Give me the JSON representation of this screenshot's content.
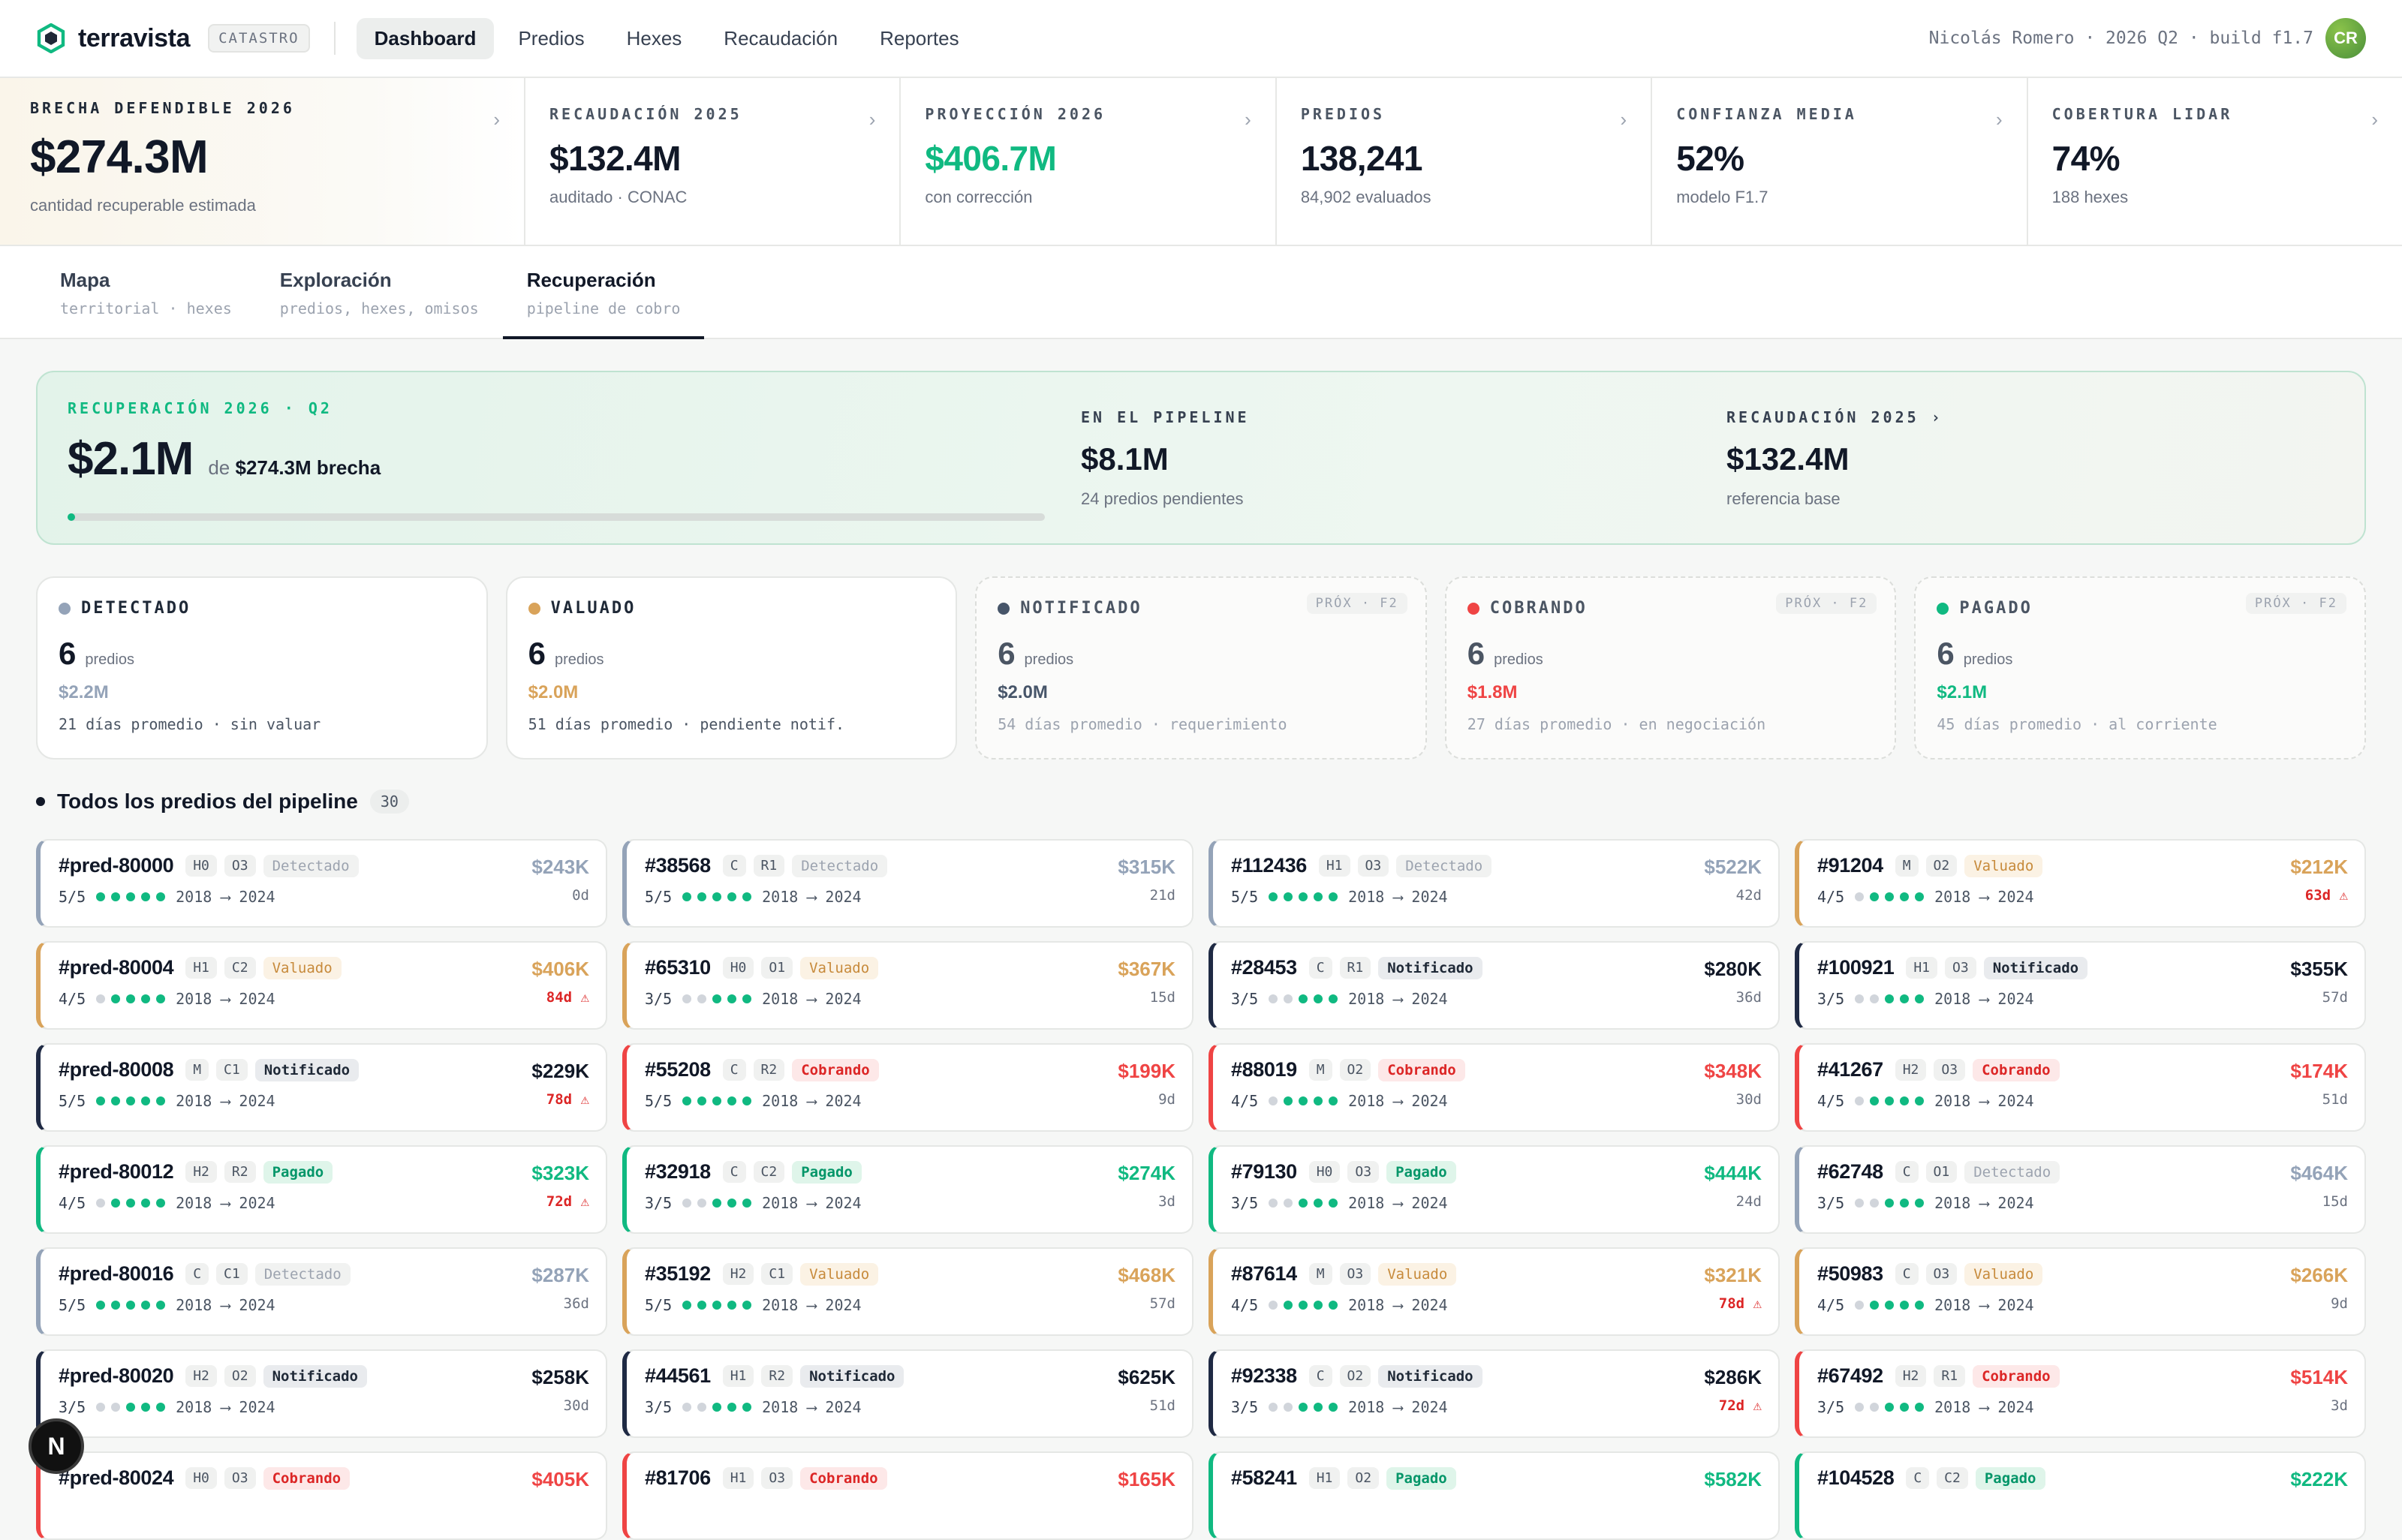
{
  "app": {
    "name": "terravista",
    "tag": "CATASTRO",
    "user_info": "Nicolás Romero · 2026 Q2 · build f1.7",
    "avatar": "CR"
  },
  "nav": [
    {
      "label": "Dashboard",
      "active": true
    },
    {
      "label": "Predios"
    },
    {
      "label": "Hexes"
    },
    {
      "label": "Recaudación"
    },
    {
      "label": "Reportes"
    }
  ],
  "kpis": [
    {
      "label": "BRECHA DEFENDIBLE 2026",
      "value": "$274.3M",
      "sub": "cantidad recuperable estimada"
    },
    {
      "label": "RECAUDACIÓN 2025",
      "value": "$132.4M",
      "sub": "auditado · CONAC"
    },
    {
      "label": "PROYECCIÓN 2026",
      "value": "$406.7M",
      "sub": "con corrección",
      "accent": "#10b981"
    },
    {
      "label": "PREDIOS",
      "value": "138,241",
      "sub": "84,902 evaluados"
    },
    {
      "label": "CONFIANZA MEDIA",
      "value": "52%",
      "sub": "modelo F1.7"
    },
    {
      "label": "COBERTURA LIDAR",
      "value": "74%",
      "sub": "188 hexes"
    }
  ],
  "tabs": [
    {
      "title": "Mapa",
      "sub": "territorial · hexes"
    },
    {
      "title": "Exploración",
      "sub": "predios, hexes, omisos"
    },
    {
      "title": "Recuperación",
      "sub": "pipeline de cobro",
      "active": true
    }
  ],
  "recovery": {
    "label": "RECUPERACIÓN 2026 · Q2",
    "amount": "$2.1M",
    "of_text": "de",
    "of_value": "$274.3M brecha",
    "progress": 0.0077,
    "pipeline": {
      "label": "EN EL PIPELINE",
      "value": "$8.1M",
      "sub": "24 predios pendientes"
    },
    "base": {
      "label": "RECAUDACIÓN 2025 ›",
      "value": "$132.4M",
      "sub": "referencia base"
    }
  },
  "stages": [
    {
      "name": "DETECTADO",
      "count": "6",
      "unit": "predios",
      "amount": "$2.2M",
      "foot": "21 días promedio · sin valuar",
      "color": "#94a3b8"
    },
    {
      "name": "VALUADO",
      "count": "6",
      "unit": "predios",
      "amount": "$2.0M",
      "foot": "51 días promedio · pendiente notif.",
      "color": "#d9a35a"
    },
    {
      "name": "NOTIFICADO",
      "count": "6",
      "unit": "predios",
      "amount": "$2.0M",
      "foot": "54 días promedio · requerimiento",
      "color": "#475569",
      "badge": "PRÓX · F2"
    },
    {
      "name": "COBRANDO",
      "count": "6",
      "unit": "predios",
      "amount": "$1.8M",
      "foot": "27 días promedio · en negociación",
      "color": "#ef4444",
      "badge": "PRÓX · F2"
    },
    {
      "name": "PAGADO",
      "count": "6",
      "unit": "predios",
      "amount": "$2.1M",
      "foot": "45 días promedio · al corriente",
      "color": "#10b981",
      "badge": "PRÓX · F2"
    }
  ],
  "list": {
    "title": "Todos los predios del pipeline",
    "count": "30"
  },
  "cards": [
    {
      "id": "#pred-80000",
      "c1": "H0",
      "c2": "O3",
      "status": "Detectado",
      "amount": "$243K",
      "days": "0d",
      "score": "5/5",
      "dots": 5,
      "years": "2018 ⟶ 2024"
    },
    {
      "id": "#38568",
      "c1": "C",
      "c2": "R1",
      "status": "Detectado",
      "amount": "$315K",
      "days": "21d",
      "score": "5/5",
      "dots": 5,
      "years": "2018 ⟶ 2024"
    },
    {
      "id": "#112436",
      "c1": "H1",
      "c2": "O3",
      "status": "Detectado",
      "amount": "$522K",
      "days": "42d",
      "score": "5/5",
      "dots": 5,
      "years": "2018 ⟶ 2024"
    },
    {
      "id": "#91204",
      "c1": "M",
      "c2": "O2",
      "status": "Valuado",
      "amount": "$212K",
      "days": "63d ⚠",
      "warn": true,
      "score": "4/5",
      "dots": 4,
      "years": "2018 ⟶ 2024"
    },
    {
      "id": "#pred-80004",
      "c1": "H1",
      "c2": "C2",
      "status": "Valuado",
      "amount": "$406K",
      "days": "84d ⚠",
      "warn": true,
      "score": "4/5",
      "dots": 4,
      "years": "2018 ⟶ 2024"
    },
    {
      "id": "#65310",
      "c1": "H0",
      "c2": "O1",
      "status": "Valuado",
      "amount": "$367K",
      "days": "15d",
      "score": "3/5",
      "dots": 3,
      "years": "2018 ⟶ 2024"
    },
    {
      "id": "#28453",
      "c1": "C",
      "c2": "R1",
      "status": "Notificado",
      "amount": "$280K",
      "days": "36d",
      "score": "3/5",
      "dots": 3,
      "years": "2018 ⟶ 2024"
    },
    {
      "id": "#100921",
      "c1": "H1",
      "c2": "O3",
      "status": "Notificado",
      "amount": "$355K",
      "days": "57d",
      "score": "3/5",
      "dots": 3,
      "years": "2018 ⟶ 2024"
    },
    {
      "id": "#pred-80008",
      "c1": "M",
      "c2": "C1",
      "status": "Notificado",
      "amount": "$229K",
      "days": "78d ⚠",
      "warn": true,
      "score": "5/5",
      "dots": 5,
      "years": "2018 ⟶ 2024"
    },
    {
      "id": "#55208",
      "c1": "C",
      "c2": "R2",
      "status": "Cobrando",
      "amount": "$199K",
      "days": "9d",
      "score": "5/5",
      "dots": 5,
      "years": "2018 ⟶ 2024"
    },
    {
      "id": "#88019",
      "c1": "M",
      "c2": "O2",
      "status": "Cobrando",
      "amount": "$348K",
      "days": "30d",
      "score": "4/5",
      "dots": 4,
      "years": "2018 ⟶ 2024"
    },
    {
      "id": "#41267",
      "c1": "H2",
      "c2": "O3",
      "status": "Cobrando",
      "amount": "$174K",
      "days": "51d",
      "score": "4/5",
      "dots": 4,
      "years": "2018 ⟶ 2024"
    },
    {
      "id": "#pred-80012",
      "c1": "H2",
      "c2": "R2",
      "status": "Pagado",
      "amount": "$323K",
      "days": "72d ⚠",
      "warn": true,
      "score": "4/5",
      "dots": 4,
      "years": "2018 ⟶ 2024"
    },
    {
      "id": "#32918",
      "c1": "C",
      "c2": "C2",
      "status": "Pagado",
      "amount": "$274K",
      "days": "3d",
      "score": "3/5",
      "dots": 3,
      "years": "2018 ⟶ 2024"
    },
    {
      "id": "#79130",
      "c1": "H0",
      "c2": "O3",
      "status": "Pagado",
      "amount": "$444K",
      "days": "24d",
      "score": "3/5",
      "dots": 3,
      "years": "2018 ⟶ 2024"
    },
    {
      "id": "#62748",
      "c1": "C",
      "c2": "O1",
      "status": "Detectado",
      "amount": "$464K",
      "days": "15d",
      "score": "3/5",
      "dots": 3,
      "years": "2018 ⟶ 2024"
    },
    {
      "id": "#pred-80016",
      "c1": "C",
      "c2": "C1",
      "status": "Detectado",
      "amount": "$287K",
      "days": "36d",
      "score": "5/5",
      "dots": 5,
      "years": "2018 ⟶ 2024"
    },
    {
      "id": "#35192",
      "c1": "H2",
      "c2": "C1",
      "status": "Valuado",
      "amount": "$468K",
      "days": "57d",
      "score": "5/5",
      "dots": 5,
      "years": "2018 ⟶ 2024"
    },
    {
      "id": "#87614",
      "c1": "M",
      "c2": "O3",
      "status": "Valuado",
      "amount": "$321K",
      "days": "78d ⚠",
      "warn": true,
      "score": "4/5",
      "dots": 4,
      "years": "2018 ⟶ 2024"
    },
    {
      "id": "#50983",
      "c1": "C",
      "c2": "O3",
      "status": "Valuado",
      "amount": "$266K",
      "days": "9d",
      "score": "4/5",
      "dots": 4,
      "years": "2018 ⟶ 2024"
    },
    {
      "id": "#pred-80020",
      "c1": "H2",
      "c2": "O2",
      "status": "Notificado",
      "amount": "$258K",
      "days": "30d",
      "score": "3/5",
      "dots": 3,
      "years": "2018 ⟶ 2024"
    },
    {
      "id": "#44561",
      "c1": "H1",
      "c2": "R2",
      "status": "Notificado",
      "amount": "$625K",
      "days": "51d",
      "score": "3/5",
      "dots": 3,
      "years": "2018 ⟶ 2024"
    },
    {
      "id": "#92338",
      "c1": "C",
      "c2": "O2",
      "status": "Notificado",
      "amount": "$286K",
      "days": "72d ⚠",
      "warn": true,
      "score": "3/5",
      "dots": 3,
      "years": "2018 ⟶ 2024"
    },
    {
      "id": "#67492",
      "c1": "H2",
      "c2": "R1",
      "status": "Cobrando",
      "amount": "$514K",
      "days": "3d",
      "score": "3/5",
      "dots": 3,
      "years": "2018 ⟶ 2024"
    },
    {
      "id": "#pred-80024",
      "c1": "H0",
      "c2": "O3",
      "status": "Cobrando",
      "amount": "$405K",
      "days": "",
      "score": "",
      "dots": 0,
      "years": ""
    },
    {
      "id": "#81706",
      "c1": "H1",
      "c2": "O3",
      "status": "Cobrando",
      "amount": "$165K",
      "days": "",
      "score": "",
      "dots": 0,
      "years": ""
    },
    {
      "id": "#58241",
      "c1": "H1",
      "c2": "O2",
      "status": "Pagado",
      "amount": "$582K",
      "days": "",
      "score": "",
      "dots": 0,
      "years": ""
    },
    {
      "id": "#104528",
      "c1": "C",
      "c2": "C2",
      "status": "Pagado",
      "amount": "$222K",
      "days": "",
      "score": "",
      "dots": 0,
      "years": ""
    }
  ],
  "dev_badge": "N"
}
